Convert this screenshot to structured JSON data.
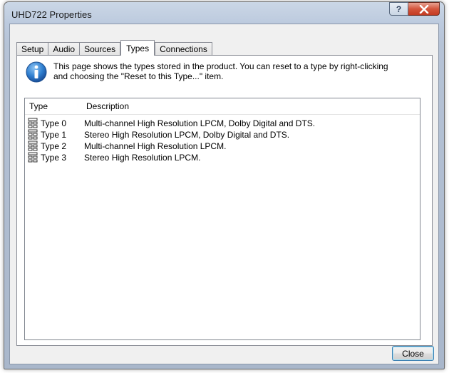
{
  "window": {
    "title": "UHD722 Properties",
    "help_label": "?",
    "close_glyph": "x"
  },
  "tabs": [
    {
      "label": "Setup",
      "active": false
    },
    {
      "label": "Audio",
      "active": false
    },
    {
      "label": "Sources",
      "active": false
    },
    {
      "label": "Types",
      "active": true
    },
    {
      "label": "Connections",
      "active": false
    }
  ],
  "info": {
    "icon": "info-icon",
    "text_line1": "This page shows the types stored in the product. You can reset to a type by right-clicking",
    "text_line2": "and choosing the \"Reset to this Type...\" item."
  },
  "list": {
    "columns": {
      "type": "Type",
      "description": "Description"
    },
    "rows": [
      {
        "icon": "type-icon",
        "type": "Type 0",
        "description": "Multi-channel High Resolution LPCM, Dolby Digital and DTS."
      },
      {
        "icon": "type-icon",
        "type": "Type 1",
        "description": "Stereo High Resolution LPCM, Dolby Digital and DTS."
      },
      {
        "icon": "type-icon",
        "type": "Type 2",
        "description": "Multi-channel High Resolution LPCM."
      },
      {
        "icon": "type-icon",
        "type": "Type 3",
        "description": "Stereo High Resolution LPCM."
      }
    ]
  },
  "footer": {
    "close_label": "Close"
  },
  "colors": {
    "accent": "#3c7fb1",
    "close_button_red": "#c43a22"
  }
}
